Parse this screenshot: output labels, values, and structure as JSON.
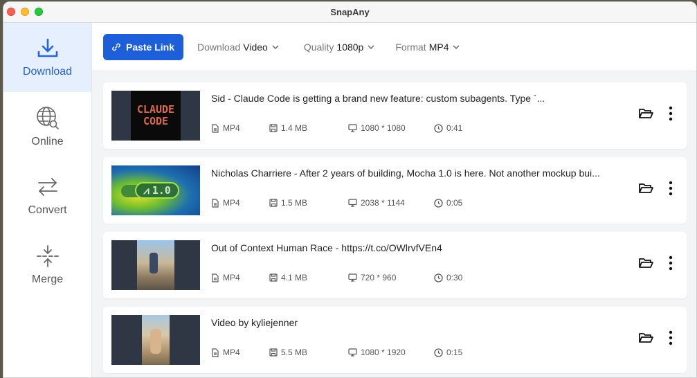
{
  "window": {
    "title": "SnapAny"
  },
  "sidebar": {
    "items": [
      {
        "label": "Download",
        "icon": "download-icon",
        "active": true
      },
      {
        "label": "Online",
        "icon": "globe-search-icon"
      },
      {
        "label": "Convert",
        "icon": "convert-arrows-icon"
      },
      {
        "label": "Merge",
        "icon": "merge-icon"
      }
    ]
  },
  "toolbar": {
    "paste_label": "Paste Link",
    "download": {
      "label": "Download",
      "value": "Video"
    },
    "quality": {
      "label": "Quality",
      "value": "1080p"
    },
    "format": {
      "label": "Format",
      "value": "MP4"
    }
  },
  "colors": {
    "accent": "#1d5fd8",
    "active_bg": "#e6effd"
  },
  "videos": [
    {
      "title": "Sid - Claude Code is getting a brand new feature: custom subagents. Type `...",
      "format": "MP4",
      "size": "1.4 MB",
      "resolution": "1080 * 1080",
      "duration": "0:41",
      "thumb_text_1": "CLAUDE",
      "thumb_text_2": "CODE"
    },
    {
      "title": "Nicholas Charriere - After 2 years of building, Mocha 1.0 is here. Not another mockup bui...",
      "format": "MP4",
      "size": "1.5 MB",
      "resolution": "2038 * 1144",
      "duration": "0:05",
      "thumb_text": "1.0"
    },
    {
      "title": "Out of Context Human Race - https://t.co/OWlrvfVEn4",
      "format": "MP4",
      "size": "4.1 MB",
      "resolution": "720 * 960",
      "duration": "0:30"
    },
    {
      "title": "Video by kyliejenner",
      "format": "MP4",
      "size": "5.5 MB",
      "resolution": "1080 * 1920",
      "duration": "0:15"
    }
  ]
}
